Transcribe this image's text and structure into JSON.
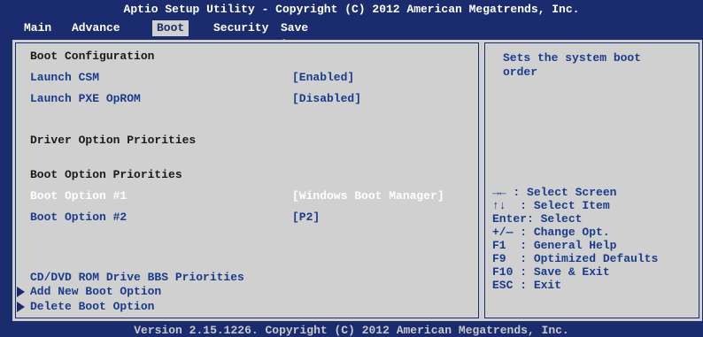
{
  "title": "Aptio Setup Utility - Copyright (C) 2012 American Megatrends, Inc.",
  "menu": [
    {
      "label": "Main"
    },
    {
      "label": "Advance"
    },
    {
      "label": "Boot"
    },
    {
      "label": "Security"
    },
    {
      "label": "Save & Exit"
    }
  ],
  "active_menu": "Boot",
  "boot": {
    "section_config": "Boot Configuration",
    "launch_csm": {
      "label": "Launch CSM",
      "value": "[Enabled]"
    },
    "launch_pxe": {
      "label": "Launch PXE OpROM",
      "value": "[Disabled]"
    },
    "section_driver": "Driver Option Priorities",
    "section_boot_priorities": "Boot Option Priorities",
    "boot_option_1": {
      "label": "Boot Option #1",
      "value": "[Windows Boot Manager]"
    },
    "boot_option_2": {
      "label": "Boot Option #2",
      "value": "[P2]"
    },
    "cdvd_bbs": "CD/DVD ROM Drive BBS Priorities",
    "add_new_boot_option": "Add New Boot Option",
    "delete_boot_option": "Delete Boot Option"
  },
  "help": {
    "text": "Sets the system boot order"
  },
  "keys": [
    {
      "key": "→←",
      "desc": ": Select Screen"
    },
    {
      "key": "↑↓",
      "desc": ": Select Item"
    },
    {
      "key": "Enter:",
      "desc": "Select"
    },
    {
      "key": "+/—",
      "desc": ": Change Opt."
    },
    {
      "key": "F1",
      "desc": ": General Help"
    },
    {
      "key": "F9",
      "desc": ": Optimized Defaults"
    },
    {
      "key": "F10",
      "desc": ": Save & Exit"
    },
    {
      "key": "ESC",
      "desc": ": Exit"
    }
  ],
  "version": "Version 2.15.1226. Copyright (C) 2012 American Megatrends, Inc.",
  "colors": {
    "background": "#1b2c6e",
    "panel": "#d0d0d0",
    "highlight_text": "#ffffff",
    "item_text": "#1b3c8c"
  }
}
